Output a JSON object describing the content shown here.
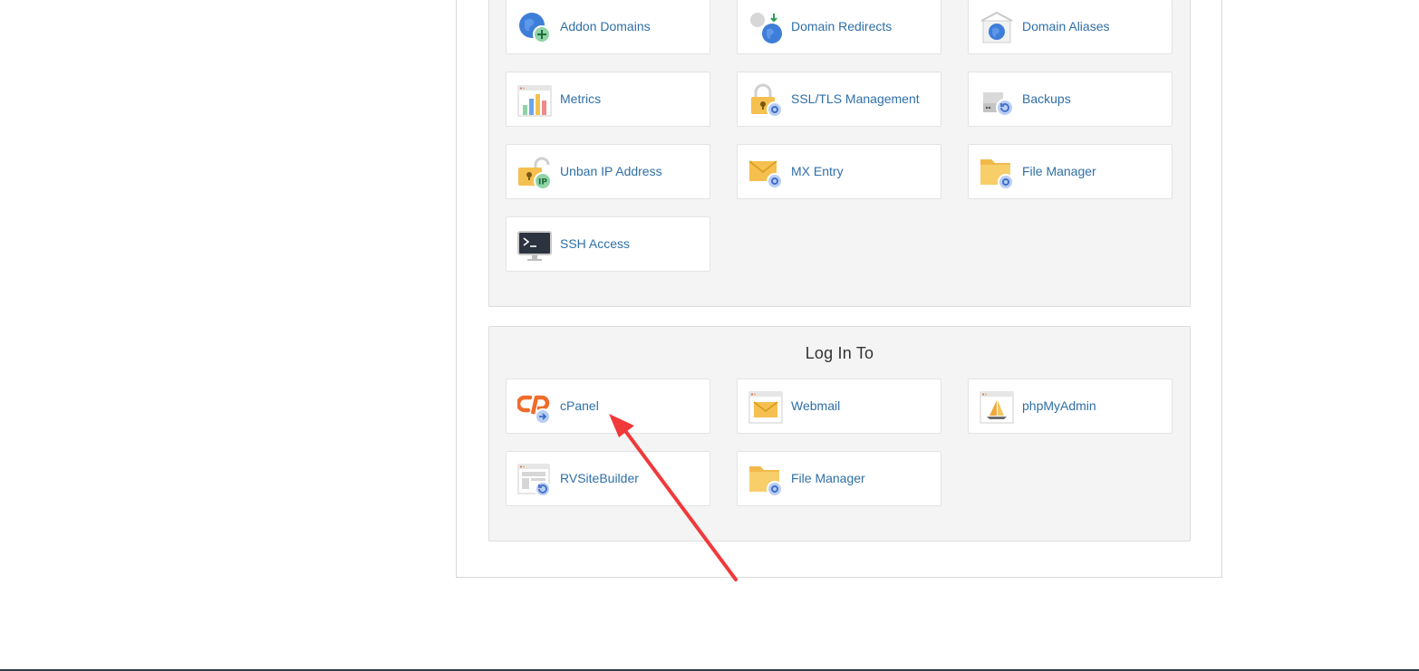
{
  "tools": [
    {
      "label": "Addon Domains",
      "icon": "addon-domains-icon"
    },
    {
      "label": "Domain Redirects",
      "icon": "domain-redirects-icon"
    },
    {
      "label": "Domain Aliases",
      "icon": "domain-aliases-icon"
    },
    {
      "label": "Metrics",
      "icon": "metrics-icon"
    },
    {
      "label": "SSL/TLS Management",
      "icon": "ssl-lock-icon"
    },
    {
      "label": "Backups",
      "icon": "backups-icon"
    },
    {
      "label": "Unban IP Address",
      "icon": "unban-ip-icon"
    },
    {
      "label": "MX Entry",
      "icon": "mx-entry-icon"
    },
    {
      "label": "File Manager",
      "icon": "file-manager-icon"
    },
    {
      "label": "SSH Access",
      "icon": "ssh-terminal-icon"
    }
  ],
  "login": {
    "title": "Log In To",
    "items": [
      {
        "label": "cPanel",
        "icon": "cpanel-logo-icon"
      },
      {
        "label": "Webmail",
        "icon": "webmail-icon"
      },
      {
        "label": "phpMyAdmin",
        "icon": "phpmyadmin-icon"
      },
      {
        "label": "RVSiteBuilder",
        "icon": "rvsitebuilder-icon"
      },
      {
        "label": "File Manager",
        "icon": "file-manager-icon"
      }
    ]
  },
  "colors": {
    "link": "#2f6fa7",
    "panel_bg": "#f4f4f4",
    "annotation_arrow": "#f0393b"
  }
}
